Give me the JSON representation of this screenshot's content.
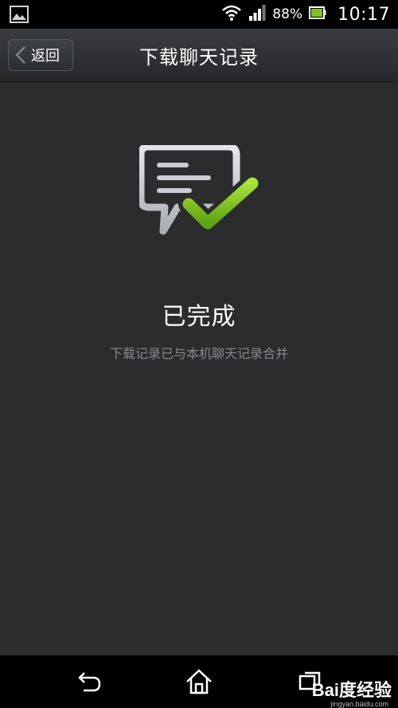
{
  "status_bar": {
    "battery_percent": "88%",
    "time": "10:17",
    "icons": [
      "gallery-icon",
      "wifi-icon",
      "signal-icon",
      "battery-icon"
    ]
  },
  "header": {
    "back_label": "返回",
    "title": "下载聊天记录"
  },
  "main": {
    "status_title": "已完成",
    "status_message": "下载记录已与本机聊天记录合并",
    "icon": "chat-check-icon",
    "accent_color": "#7dc21e"
  },
  "nav_bar": {
    "buttons": [
      "back-icon",
      "home-icon",
      "recent-apps-icon"
    ]
  },
  "watermark": {
    "text": "Bai度经验",
    "url": "jingyan.baidu.com"
  }
}
